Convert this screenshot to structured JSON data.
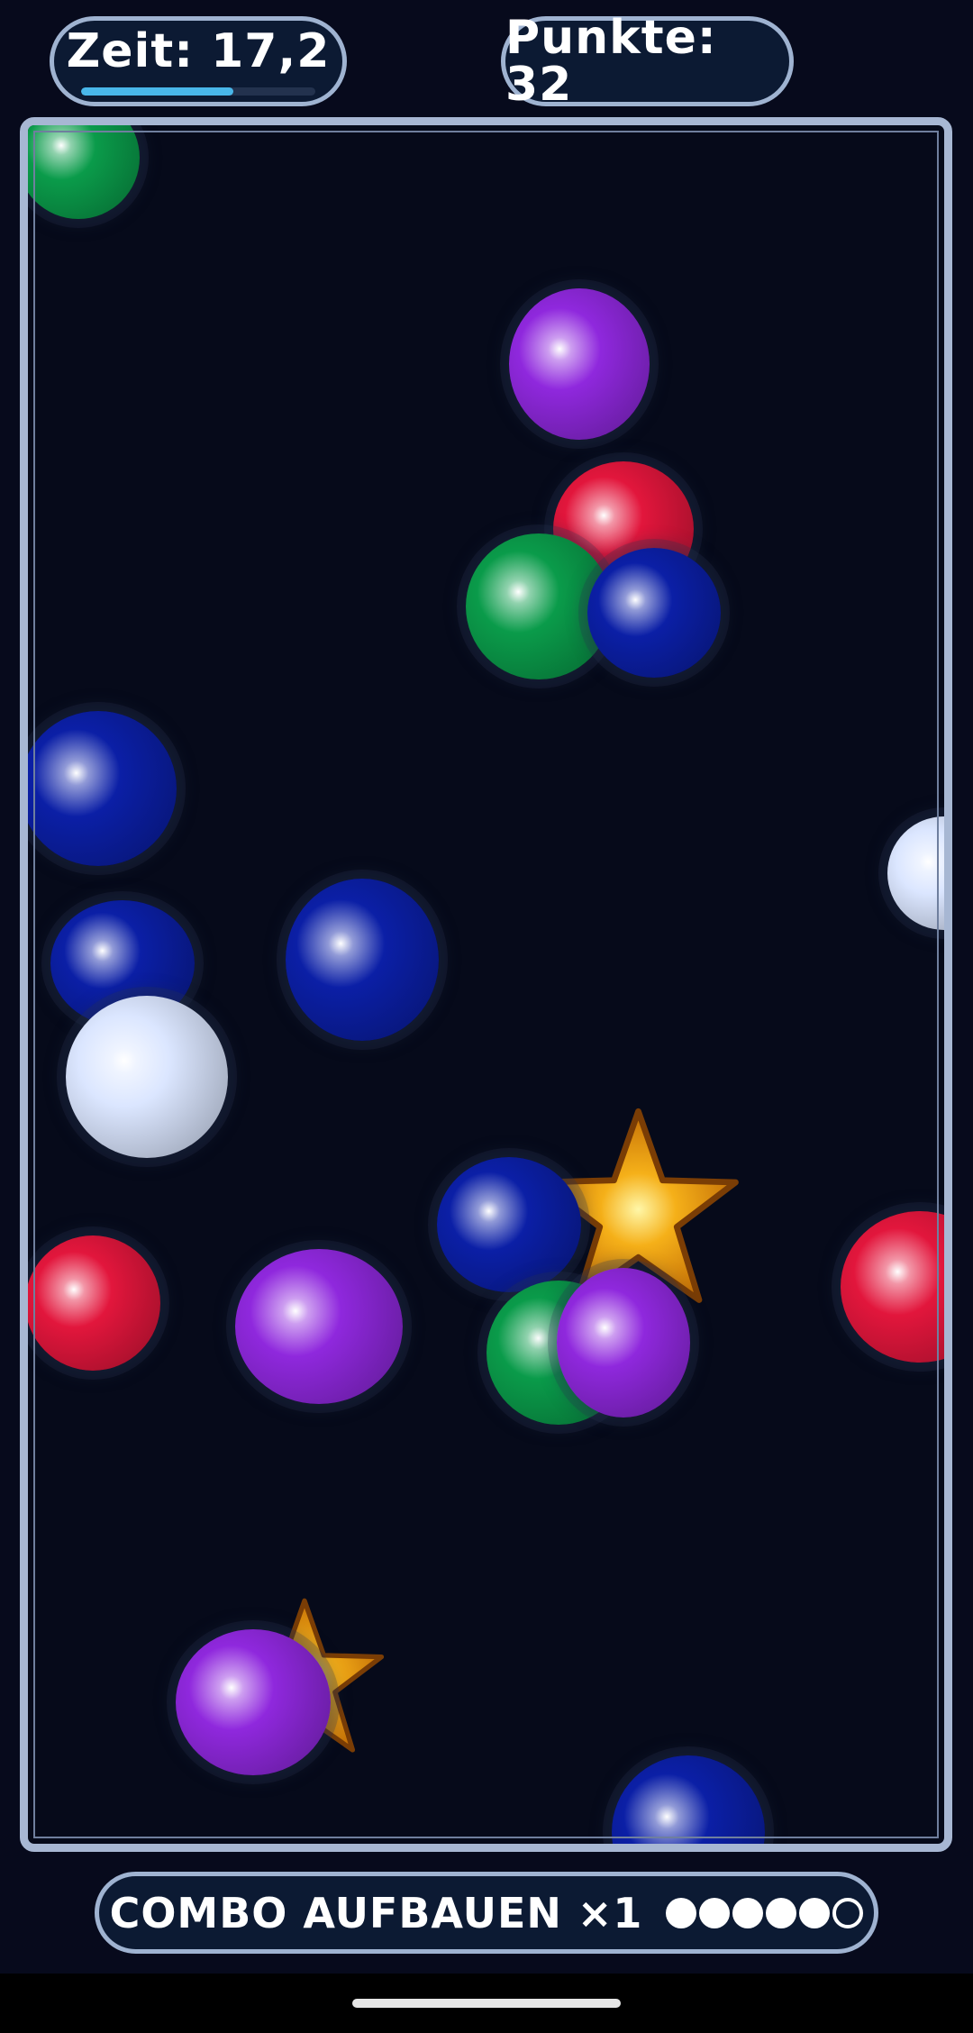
{
  "hud": {
    "timer_text": "Zeit: 17,2",
    "timer_progress": 0.65,
    "score_text": "Punkte: 32"
  },
  "combo": {
    "label": "COMBO AUFBAUEN ×1",
    "dots_total": 6,
    "dots_filled": 5
  },
  "colors": {
    "background": "#070a1c",
    "red": "#e2163c",
    "green": "#0a9b4a",
    "blue": "#0b1fa6",
    "purple": "#8f28dd",
    "white": "#dbe6ff",
    "star": "#f5b019",
    "frame": "#a7b7d3"
  },
  "field_objects": {
    "balls": [
      "green",
      "purple",
      "red",
      "green",
      "blue",
      "blue",
      "white",
      "blue",
      "blue",
      "white",
      "blue",
      "red",
      "purple",
      "red",
      "green",
      "purple",
      "purple",
      "blue"
    ],
    "stars": [
      "star",
      "star"
    ]
  }
}
